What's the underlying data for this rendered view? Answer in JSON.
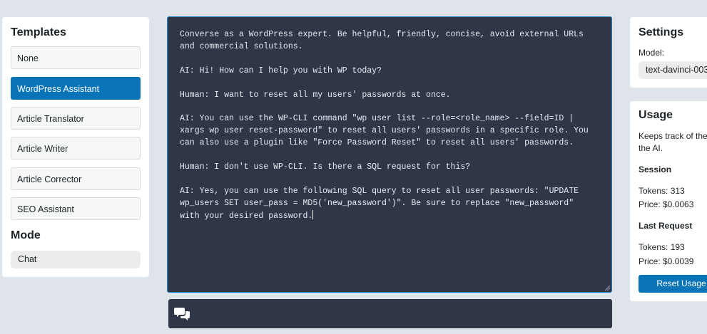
{
  "templates": {
    "title": "Templates",
    "items": [
      {
        "label": "None"
      },
      {
        "label": "WordPress Assistant"
      },
      {
        "label": "Article Translator"
      },
      {
        "label": "Article Writer"
      },
      {
        "label": "Article Corrector"
      },
      {
        "label": "SEO Assistant"
      }
    ],
    "active_index": 1
  },
  "mode": {
    "title": "Mode",
    "selected": "Chat"
  },
  "chat": {
    "lines": [
      "Converse as a WordPress expert. Be helpful, friendly, concise, avoid external URLs",
      "and commercial solutions.",
      "",
      "AI: Hi! How can I help you with WP today?",
      "",
      "Human: I want to reset all my users' passwords at once.",
      "",
      "AI: You can use the WP-CLI command \"wp user list --role=<role_name> --field=ID |",
      "xargs wp user reset-password\" to reset all users' passwords in a specific role. You",
      "can also use a plugin like \"Force Password Reset\" to reset all users' passwords.",
      "",
      "Human: I don't use WP-CLI. Is there a SQL request for this?",
      "",
      "AI: Yes, you can use the following SQL query to reset all user passwords: \"UPDATE",
      "wp_users SET user_pass = MD5('new_password')\". Be sure to replace \"new_password\"",
      "with your desired password."
    ],
    "send_icon": "speech-bubbles-icon"
  },
  "settings": {
    "title": "Settings",
    "model_label": "Model:",
    "model_value": "text-davinci-003"
  },
  "usage": {
    "title": "Usage",
    "description": "Keeps track of the",
    "description2": "the AI.",
    "session_title": "Session",
    "session_tokens": "Tokens: 313",
    "session_price": "Price: $0.0063",
    "last_title": "Last Request",
    "last_tokens": "Tokens: 193",
    "last_price": "Price: $0.0039",
    "reset_label": "Reset Usage"
  },
  "colors": {
    "accent": "#0a74b9",
    "chat_bg": "#2e3648",
    "page_bg": "#dfe3ea"
  }
}
